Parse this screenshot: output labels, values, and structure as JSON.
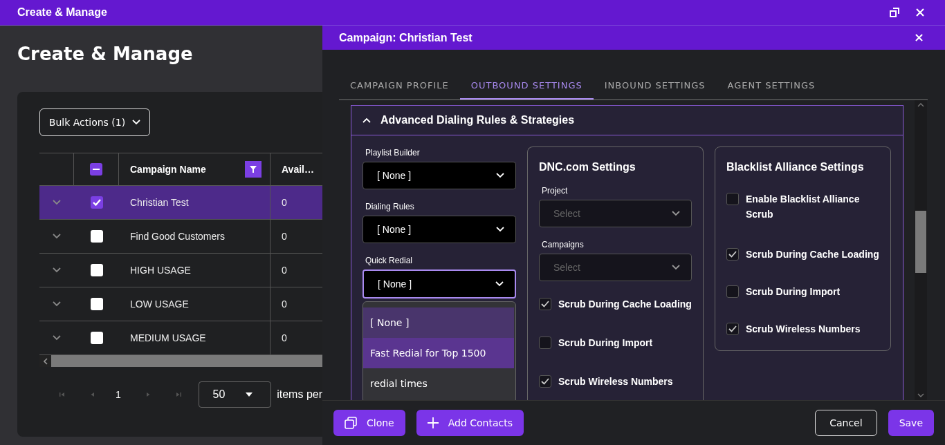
{
  "window": {
    "title": "Create & Manage"
  },
  "page": {
    "heading": "Create & Manage",
    "bulk_actions": "Bulk Actions (1)",
    "table": {
      "select_all": {
        "indeterminate": true
      },
      "columns": [
        {
          "label": "Campaign Name",
          "filter_active": true
        },
        {
          "label": "Avail…"
        }
      ],
      "rows": [
        {
          "name": "Christian Test",
          "available": "0",
          "selected": true
        },
        {
          "name": "Find Good Customers",
          "available": "0",
          "selected": false
        },
        {
          "name": "HIGH USAGE",
          "available": "0",
          "selected": false
        },
        {
          "name": "LOW USAGE",
          "available": "0",
          "selected": false
        },
        {
          "name": "MEDIUM USAGE",
          "available": "0",
          "selected": false
        }
      ]
    },
    "pagination": {
      "page": "1",
      "page_size": "50",
      "suffix": "items per"
    }
  },
  "panel": {
    "title": "Campaign: Christian Test",
    "tabs": [
      {
        "label": "CAMPAIGN PROFILE",
        "selected": false
      },
      {
        "label": "OUTBOUND SETTINGS",
        "selected": true
      },
      {
        "label": "INBOUND SETTINGS",
        "selected": false
      },
      {
        "label": "AGENT SETTINGS",
        "selected": false
      }
    ],
    "section": {
      "title": "Advanced Dialing Rules & Strategies",
      "expanded": true,
      "selects": [
        {
          "label": "Playlist Builder",
          "value": "[ None ]",
          "open": false
        },
        {
          "label": "Dialing Rules",
          "value": "[ None ]",
          "open": false
        },
        {
          "label": "Quick Redial",
          "value": "[ None ]",
          "open": true,
          "options": [
            {
              "label": "[ None ]",
              "selected": true,
              "highlighted": false
            },
            {
              "label": "Fast Redial for Top 1500",
              "selected": false,
              "highlighted": true
            },
            {
              "label": "redial times",
              "selected": false,
              "highlighted": false
            }
          ]
        }
      ],
      "dnc": {
        "title": "DNC.com Settings",
        "fields": [
          {
            "label": "Project",
            "placeholder": "Select"
          },
          {
            "label": "Campaigns",
            "placeholder": "Select"
          }
        ],
        "checks": [
          {
            "label": "Scrub During Cache Loading",
            "checked": true
          },
          {
            "label": "Scrub During Import",
            "checked": false
          },
          {
            "label": "Scrub Wireless Numbers",
            "checked": true
          }
        ]
      },
      "blacklist": {
        "title": "Blacklist Alliance Settings",
        "checks": [
          {
            "label": "Enable Blacklist Alliance Scrub",
            "checked": false
          },
          {
            "label": "Scrub During Cache Loading",
            "checked": true
          },
          {
            "label": "Scrub During Import",
            "checked": false
          },
          {
            "label": "Scrub Wireless Numbers",
            "checked": true
          }
        ]
      }
    },
    "footer": {
      "buttons": [
        {
          "label": "Clone",
          "kind": "clone"
        },
        {
          "label": "Add Contacts",
          "kind": "add"
        },
        {
          "label": "Cancel",
          "kind": "cancel"
        },
        {
          "label": "Save",
          "kind": "save"
        }
      ]
    }
  }
}
